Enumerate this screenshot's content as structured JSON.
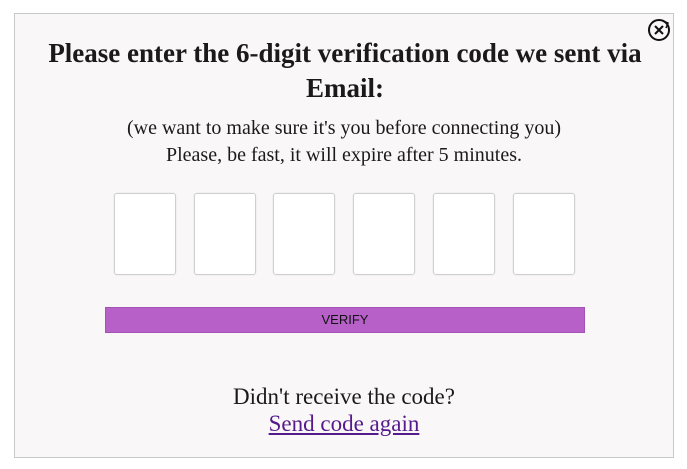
{
  "dialog": {
    "title": "Please enter the 6-digit verification code we sent via Email:",
    "subtitle_line1": "(we want to make sure it's you before connecting you)",
    "subtitle_line2": "Please, be fast, it will expire after 5 minutes.",
    "close_icon": "close-circle-arrow-icon"
  },
  "code_inputs": [
    {
      "value": ""
    },
    {
      "value": ""
    },
    {
      "value": ""
    },
    {
      "value": ""
    },
    {
      "value": ""
    },
    {
      "value": ""
    }
  ],
  "verify_button": {
    "label": "VERIFY",
    "color": "#b660c8"
  },
  "resend": {
    "question": "Didn't receive the code?",
    "link_label": "Send code again",
    "link_color": "#551a8b"
  }
}
